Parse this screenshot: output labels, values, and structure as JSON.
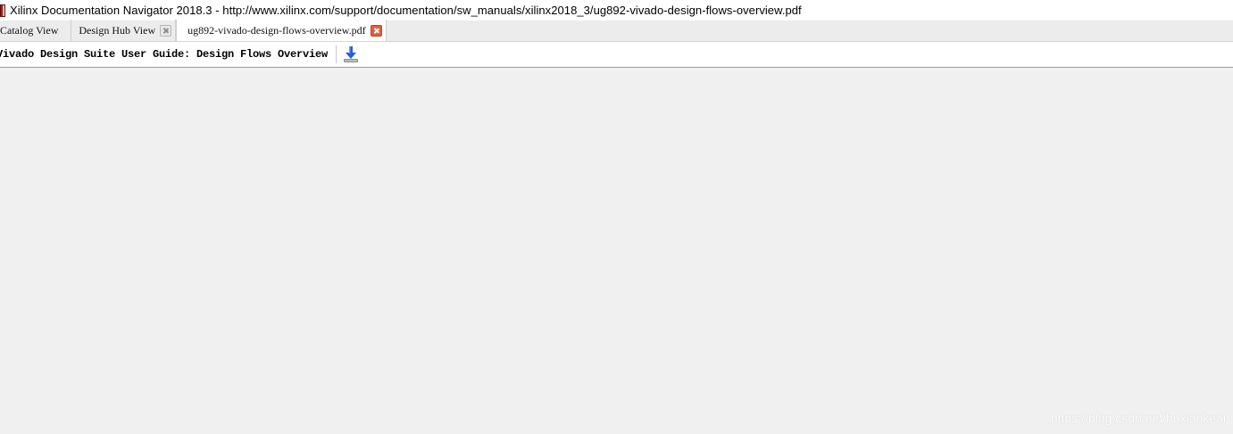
{
  "window": {
    "title": "Xilinx Documentation Navigator 2018.3 -  http://www.xilinx.com/support/documentation/sw_manuals/xilinx2018_3/ug892-vivado-design-flows-overview.pdf",
    "icon": "xilinx-docnav-icon"
  },
  "tabs": [
    {
      "label": "Catalog View",
      "closable": false,
      "active": false
    },
    {
      "label": "Design Hub View",
      "closable": true,
      "active": false
    },
    {
      "label": "ug892-vivado-design-flows-overview.pdf",
      "closable": true,
      "active": true
    }
  ],
  "document_toolbar": {
    "title": "Vivado Design Suite User Guide: Design Flows Overview",
    "download_icon": "download-icon"
  },
  "watermark": "https://blog.csdn.net/huxiaokeai",
  "colors": {
    "content_bg": "#f0f0f0",
    "active_close": "#e06040",
    "download_arrow": "#2a5bd7"
  }
}
